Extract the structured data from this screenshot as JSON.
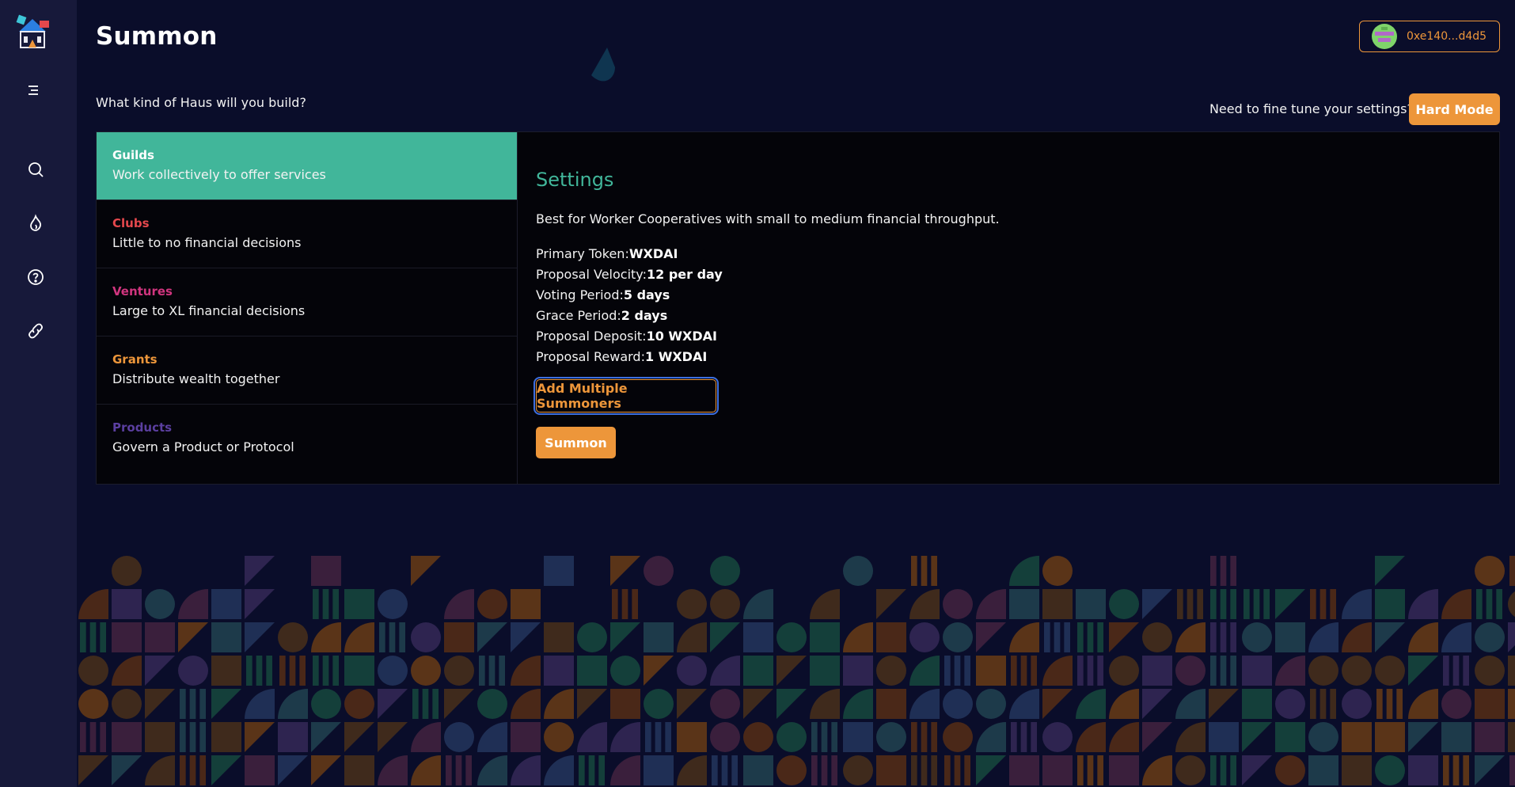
{
  "sidebar": {
    "icons": [
      "menu-icon",
      "search-icon",
      "flame-icon",
      "help-icon",
      "link-icon"
    ]
  },
  "header": {
    "title": "Summon",
    "wallet_address": "0xe140...d4d5"
  },
  "prompt": {
    "question": "What kind of Haus will you build?",
    "fine_tune": "Need to fine tune your settings?",
    "hard_mode_label": "Hard Mode"
  },
  "dao_types": [
    {
      "name": "Guilds",
      "desc": "Work collectively to offer services",
      "color": "#ffffff"
    },
    {
      "name": "Clubs",
      "desc": "Little to no financial decisions",
      "color": "#e5484d"
    },
    {
      "name": "Ventures",
      "desc": "Large to XL financial decisions",
      "color": "#d1357f"
    },
    {
      "name": "Grants",
      "desc": "Distribute wealth together",
      "color": "#ed963a"
    },
    {
      "name": "Products",
      "desc": "Govern a Product or Protocol",
      "color": "#5b3fa0"
    }
  ],
  "settings": {
    "title": "Settings",
    "description": "Best for Worker Cooperatives with small to medium financial throughput.",
    "rows": [
      {
        "label": "Primary Token:",
        "value": "WXDAI"
      },
      {
        "label": "Proposal Velocity:",
        "value": "12 per day"
      },
      {
        "label": "Voting Period:",
        "value": "5 days"
      },
      {
        "label": "Grace Period:",
        "value": "2 days"
      },
      {
        "label": "Proposal Deposit:",
        "value": "10 WXDAI"
      },
      {
        "label": "Proposal Reward:",
        "value": "1 WXDAI"
      }
    ],
    "add_summoners_label": "Add Multiple Summoners",
    "summon_label": "Summon"
  },
  "colors": {
    "accent": "#ed963a",
    "active": "#41b69a",
    "background": "#0a0d2a",
    "sidebar": "#17193a"
  }
}
